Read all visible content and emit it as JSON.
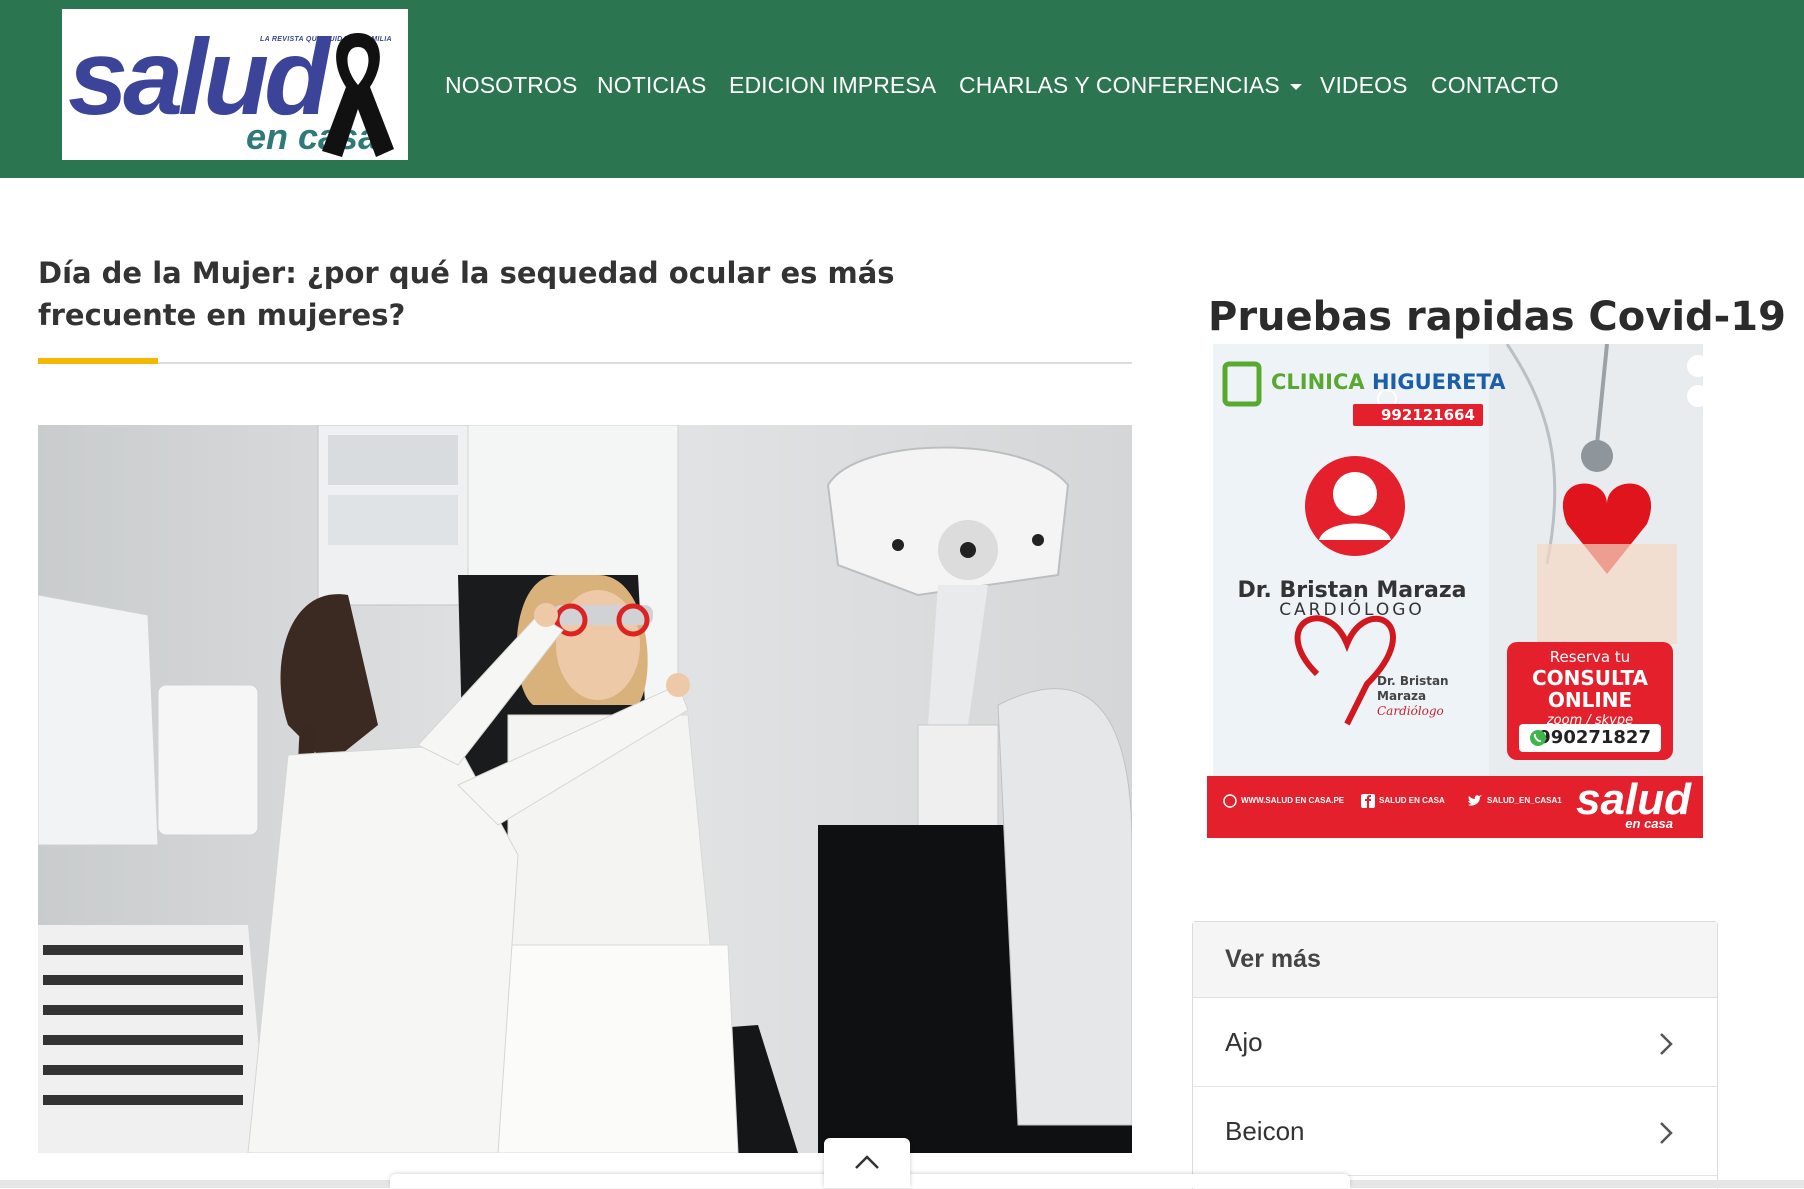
{
  "header": {
    "logo": {
      "word": "salud",
      "sub": "en casa",
      "tagline": "LA REVISTA QUE CUIDA LA FAMILIA"
    },
    "nav": [
      {
        "label": "NOSOTROS"
      },
      {
        "label": "NOTICIAS"
      },
      {
        "label": "EDICION IMPRESA"
      },
      {
        "label": "CHARLAS Y CONFERENCIAS",
        "has_dropdown": true
      },
      {
        "label": "VIDEOS"
      },
      {
        "label": "CONTACTO"
      }
    ],
    "background_color": "#2b7550"
  },
  "article": {
    "title": "Día de la Mujer: ¿por qué la sequedad ocular es más frecuente en mujeres?",
    "accent_color": "#f5b800",
    "hero_image": "optometrist fitting trial frame glasses on patient"
  },
  "sidebar": {
    "widget_title": "Pruebas rapidas Covid-19",
    "ad": {
      "clinic_a": "CLINICA",
      "clinic_b": "HIGUERETA",
      "phone": "992121664",
      "doctor": "Dr. Bristan Maraza",
      "role": "CARDIÓLOGO",
      "sign_line1": "Dr. Bristan",
      "sign_line2": "Maraza",
      "sign_line3": "Cardiólogo",
      "cta_line1": "Reserva tu",
      "cta_line2": "CONSULTA",
      "cta_line3": "ONLINE",
      "cta_platforms": "zoom / skype",
      "cta_phone": "990271827",
      "banner_web": "WWW.SALUD EN CASA.PE",
      "banner_fb": "SALUD EN CASA",
      "banner_tw": "SALUD_EN_CASA1",
      "brand": "salud",
      "brand_sub": "en casa",
      "red": "#e3202c"
    },
    "ver_mas": {
      "title": "Ver más",
      "items": [
        {
          "label": "Ajo"
        },
        {
          "label": "Beicon"
        }
      ]
    }
  }
}
